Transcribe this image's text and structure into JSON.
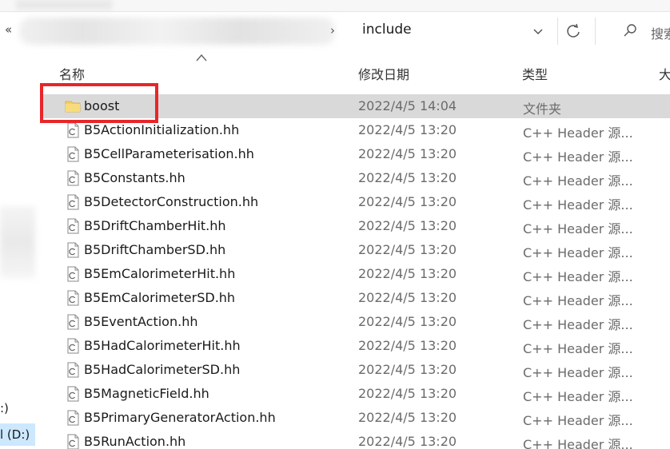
{
  "address_bar": {
    "back_chevrons": "«",
    "separator": "›",
    "current_folder": "include"
  },
  "search": {
    "placeholder": "搜索"
  },
  "nav_pane": {
    "items": [
      {
        "label": ":)"
      },
      {
        "label": "l (D:)"
      }
    ]
  },
  "columns": {
    "name": "名称",
    "date_modified": "修改日期",
    "type": "类型",
    "size": "大"
  },
  "files": [
    {
      "name": "boost",
      "date": "2022/4/5 14:04",
      "type": "文件夹",
      "icon": "folder-icon",
      "selected": true
    },
    {
      "name": "B5ActionInitialization.hh",
      "date": "2022/4/5 13:20",
      "type": "C++ Header 源...",
      "icon": "cpp-header-file-icon"
    },
    {
      "name": "B5CellParameterisation.hh",
      "date": "2022/4/5 13:20",
      "type": "C++ Header 源...",
      "icon": "cpp-header-file-icon"
    },
    {
      "name": "B5Constants.hh",
      "date": "2022/4/5 13:20",
      "type": "C++ Header 源...",
      "icon": "cpp-header-file-icon"
    },
    {
      "name": "B5DetectorConstruction.hh",
      "date": "2022/4/5 13:20",
      "type": "C++ Header 源...",
      "icon": "cpp-header-file-icon"
    },
    {
      "name": "B5DriftChamberHit.hh",
      "date": "2022/4/5 13:20",
      "type": "C++ Header 源...",
      "icon": "cpp-header-file-icon"
    },
    {
      "name": "B5DriftChamberSD.hh",
      "date": "2022/4/5 13:20",
      "type": "C++ Header 源...",
      "icon": "cpp-header-file-icon"
    },
    {
      "name": "B5EmCalorimeterHit.hh",
      "date": "2022/4/5 13:20",
      "type": "C++ Header 源...",
      "icon": "cpp-header-file-icon"
    },
    {
      "name": "B5EmCalorimeterSD.hh",
      "date": "2022/4/5 13:20",
      "type": "C++ Header 源...",
      "icon": "cpp-header-file-icon"
    },
    {
      "name": "B5EventAction.hh",
      "date": "2022/4/5 13:20",
      "type": "C++ Header 源...",
      "icon": "cpp-header-file-icon"
    },
    {
      "name": "B5HadCalorimeterHit.hh",
      "date": "2022/4/5 13:20",
      "type": "C++ Header 源...",
      "icon": "cpp-header-file-icon"
    },
    {
      "name": "B5HadCalorimeterSD.hh",
      "date": "2022/4/5 13:20",
      "type": "C++ Header 源...",
      "icon": "cpp-header-file-icon"
    },
    {
      "name": "B5MagneticField.hh",
      "date": "2022/4/5 13:20",
      "type": "C++ Header 源...",
      "icon": "cpp-header-file-icon"
    },
    {
      "name": "B5PrimaryGeneratorAction.hh",
      "date": "2022/4/5 13:20",
      "type": "C++ Header 源...",
      "icon": "cpp-header-file-icon"
    },
    {
      "name": "B5RunAction.hh",
      "date": "2022/4/5 13:20",
      "type": "C++ Header 源...",
      "icon": "cpp-header-file-icon"
    }
  ],
  "colors": {
    "selected_row": "#d9d9d9",
    "nav_selected": "#cce8ff",
    "highlight_border": "#e8262a",
    "folder_yellow": "#f5cf62",
    "secondary_text": "#6b6b6b"
  }
}
